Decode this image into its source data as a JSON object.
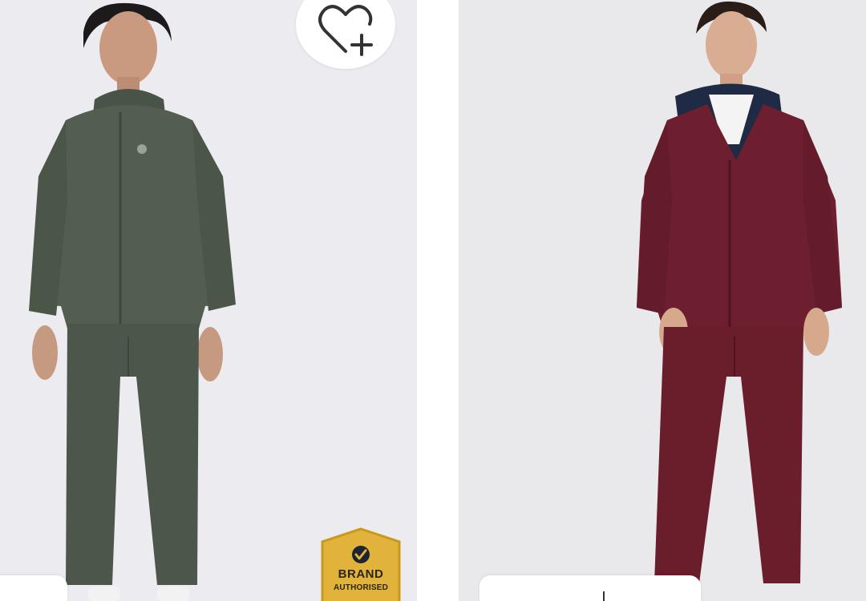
{
  "products": [
    {
      "id_label": "product-card-left",
      "jacket_color": "#4f5a4d",
      "pants_color": "#4a544a",
      "badge": {
        "line1": "BRAND",
        "line2": "AUTHORISED",
        "color": "#e2b33a"
      },
      "wishlist_icon": "heart-plus-icon"
    },
    {
      "id_label": "product-card-right",
      "jacket_color": "#6e1f2f",
      "pants_color": "#6a1d2b",
      "hood_color": "#1f2a44"
    }
  ],
  "colors": {
    "background_left": "#ecebf0",
    "background_right": "#e9e9ec",
    "badge_gold": "#e2b33a"
  }
}
